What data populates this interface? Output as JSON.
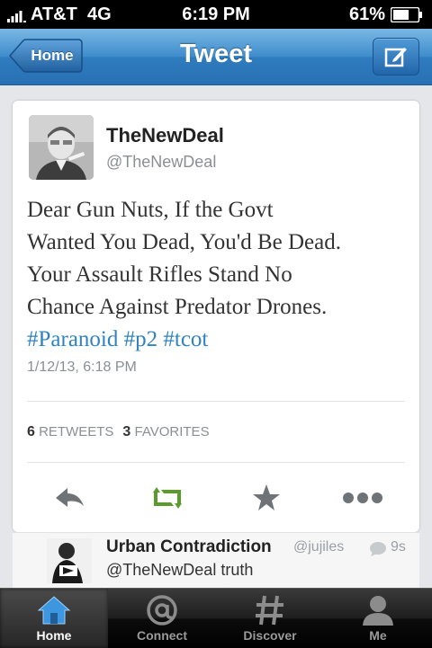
{
  "status_bar": {
    "carrier": "AT&T",
    "network": "4G",
    "time": "6:19 PM",
    "battery": "61%"
  },
  "nav": {
    "back_label": "Home",
    "title": "Tweet"
  },
  "tweet": {
    "display_name": "TheNewDeal",
    "handle": "@TheNewDeal",
    "text_lines": [
      "Dear Gun Nuts, If the Govt",
      "Wanted You Dead, You'd Be Dead.",
      "Your Assault Rifles Stand No",
      "Chance Against Predator Drones."
    ],
    "hashtags": [
      "#Paranoid",
      "#p2",
      "#tcot"
    ],
    "timestamp": "1/12/13, 6:18 PM",
    "retweets_count": "6",
    "retweets_label": "RETWEETS",
    "favorites_count": "3",
    "favorites_label": "FAVORITES"
  },
  "reply": {
    "name": "Urban Contradiction",
    "handle": "@jujiles",
    "time": "9s",
    "text": "@TheNewDeal truth"
  },
  "tabs": [
    {
      "label": "Home",
      "icon": "home-icon",
      "active": true
    },
    {
      "label": "Connect",
      "icon": "at-icon",
      "active": false
    },
    {
      "label": "Discover",
      "icon": "hash-icon",
      "active": false
    },
    {
      "label": "Me",
      "icon": "person-icon",
      "active": false
    }
  ],
  "colors": {
    "nav_blue": "#2f7cbf",
    "hashtag": "#2f83c0",
    "retweet_green": "#5a9c2c"
  }
}
